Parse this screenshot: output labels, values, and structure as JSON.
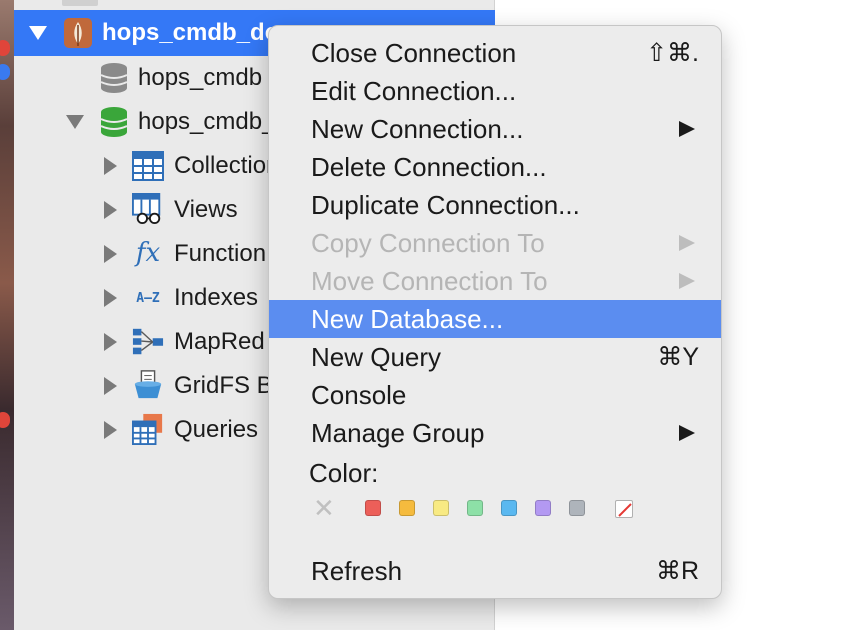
{
  "sidebar": {
    "connection": {
      "label": "hops_cmdb_doc"
    },
    "items": [
      {
        "label": "hops_cmdb",
        "icon": "database-gray-icon"
      },
      {
        "label": "hops_cmdb_",
        "icon": "database-green-icon"
      }
    ],
    "children": [
      {
        "label": "Collection",
        "icon": "table-icon"
      },
      {
        "label": "Views",
        "icon": "view-icon"
      },
      {
        "label": "Function",
        "icon": "function-icon",
        "glyph": "fx"
      },
      {
        "label": "Indexes",
        "icon": "index-icon",
        "glyph": "A–Z"
      },
      {
        "label": "MapRed",
        "icon": "mapreduce-icon"
      },
      {
        "label": "GridFS B",
        "icon": "gridfs-icon"
      },
      {
        "label": "Queries",
        "icon": "queries-icon"
      }
    ]
  },
  "menu": {
    "items": [
      {
        "label": "Close Connection",
        "shortcut": "⇧⌘.",
        "state": "normal"
      },
      {
        "label": "Edit Connection...",
        "shortcut": "",
        "state": "normal"
      },
      {
        "label": "New Connection...",
        "shortcut": "",
        "submenu": true,
        "state": "normal"
      },
      {
        "label": "Delete Connection...",
        "shortcut": "",
        "state": "normal"
      },
      {
        "label": "Duplicate Connection...",
        "shortcut": "",
        "state": "normal"
      },
      {
        "label": "Copy Connection To",
        "shortcut": "",
        "submenu": true,
        "state": "disabled"
      },
      {
        "label": "Move Connection To",
        "shortcut": "",
        "submenu": true,
        "state": "disabled"
      },
      {
        "label": "New Database...",
        "shortcut": "",
        "state": "highlighted"
      },
      {
        "label": "New Query",
        "shortcut": "⌘Y",
        "state": "normal"
      },
      {
        "label": "Console",
        "shortcut": "",
        "state": "normal"
      },
      {
        "label": "Manage Group",
        "shortcut": "",
        "submenu": true,
        "state": "normal"
      }
    ],
    "color_label": "Color:",
    "color_none_glyph": "✕",
    "colors": [
      "#ec5f59",
      "#f5bb3e",
      "#f8ea83",
      "#8de0a7",
      "#5ab8f0",
      "#b399f2",
      "#aeb4bb"
    ],
    "refresh": {
      "label": "Refresh",
      "shortcut": "⌘R"
    }
  },
  "colors": {
    "selection": "#3478f6",
    "highlight": "#5b8df0"
  }
}
